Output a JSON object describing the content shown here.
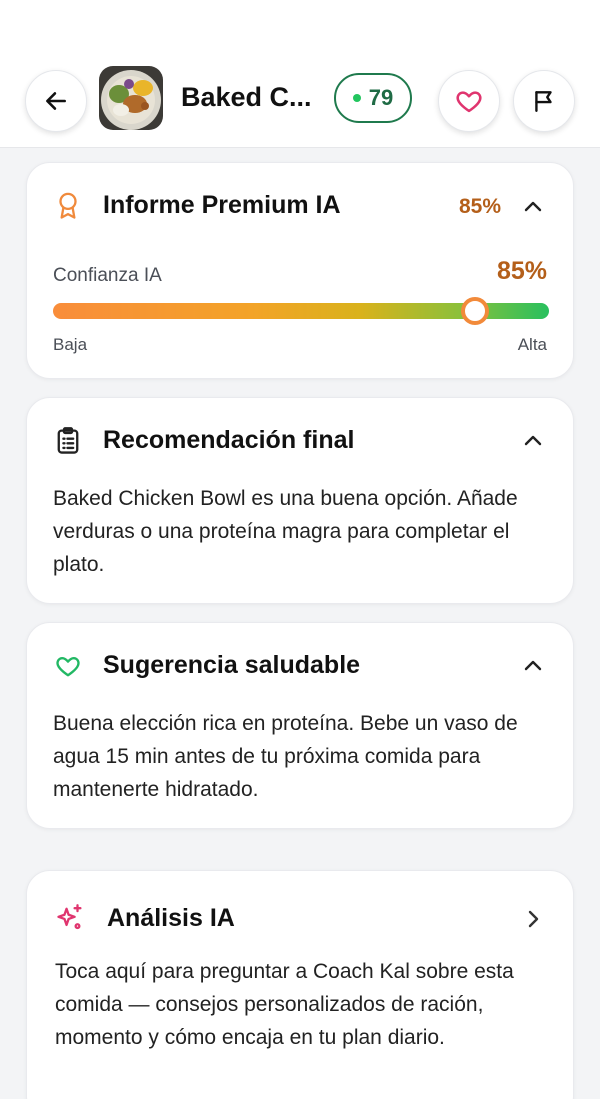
{
  "header": {
    "title": "Baked C...",
    "score": "79",
    "thumbnail_icon": "food-bowl-photo",
    "back_icon": "arrow-left-icon",
    "favorite_icon": "heart-icon",
    "report_icon": "flag-icon"
  },
  "premium": {
    "title": "Informe Premium IA",
    "percent": "85%",
    "confidence_label": "Confianza IA",
    "confidence_value": "85%",
    "confidence_fraction": 0.85,
    "scale_low": "Baja",
    "scale_high": "Alta"
  },
  "recommendation": {
    "title": "Recomendación final",
    "text": "Baked Chicken Bowl es una buena opción. Añade verduras o una proteína magra para completar el plato."
  },
  "suggestion": {
    "title": "Sugerencia saludable",
    "text": "Buena elección rica en proteína. Bebe un vaso de agua 15 min antes de tu próxima comida para mantenerte hidratado."
  },
  "analysis": {
    "title": "Análisis IA",
    "text": "Toca aquí para preguntar a Coach Kal sobre esta comida — consejos personalizados de ración, momento y cómo encaja en tu plan diario."
  },
  "colors": {
    "accent_green": "#1f7a4d",
    "accent_orange": "#b45f1a",
    "heart_pink": "#e0356f"
  }
}
